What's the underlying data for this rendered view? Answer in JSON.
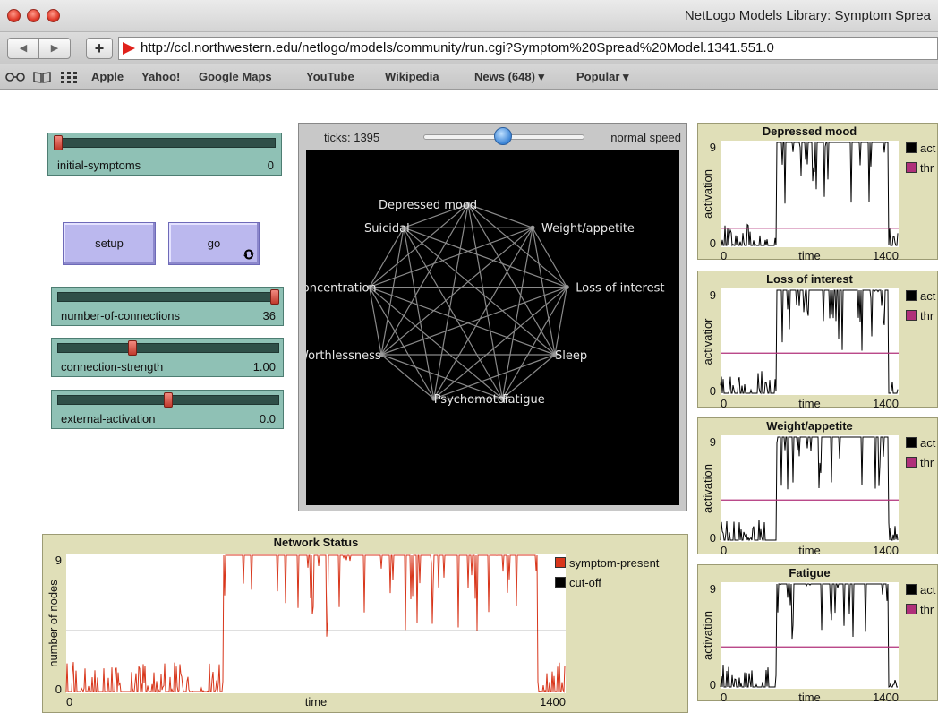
{
  "browser": {
    "window_title": "NetLogo Models Library: Symptom Sprea",
    "url": "http://ccl.northwestern.edu/netlogo/models/community/run.cgi?Symptom%20Spread%20Model.1341.551.0",
    "add_label": "+",
    "back_label": "◀",
    "forward_label": "▶",
    "bookmarks": [
      "Apple",
      "Yahoo!",
      "Google Maps",
      "YouTube",
      "Wikipedia",
      "News (648) ▾",
      "Popular ▾"
    ],
    "reader_icon": "glasses-icon",
    "book_icon": "book-icon",
    "grid_icon": "top-sites-icon"
  },
  "controls": {
    "sliders": [
      {
        "label": "initial-symptoms",
        "value": "0",
        "level": 0.0
      },
      {
        "label": "number-of-connections",
        "value": "36",
        "level": 1.0
      },
      {
        "label": "connection-strength",
        "value": "1.00",
        "level": 0.33
      },
      {
        "label": "external-activation",
        "value": "0.0",
        "level": 0.5
      }
    ],
    "setup_label": "setup",
    "go_label": "go",
    "forever_icon": "forever-icon"
  },
  "view": {
    "ticks": "ticks: 1395",
    "speed_label": "normal speed",
    "speed_level": 0.5,
    "nodes": [
      "Depressed mood",
      "Weight/appetite",
      "Loss of interest",
      "Sleep",
      "Fatigue",
      "Psychomotor",
      "Worthlessness",
      "Concentration",
      "Suicidal"
    ]
  },
  "colors": {
    "slider": "#8fc1b5",
    "button": "#bbb8ee",
    "plot_bg": "#e0dfb8",
    "symptom": "#d8361b",
    "threshold": "#b0307a"
  },
  "small_plots": [
    {
      "title": "Depressed mood",
      "ylabel": "activation",
      "xlabel": "time",
      "ymax": "9",
      "ymin": "0",
      "xmin": "0",
      "xmax": "1400",
      "legend": [
        "act",
        "thr"
      ]
    },
    {
      "title": "Loss of interest",
      "ylabel": "activatior",
      "xlabel": "time",
      "ymax": "9",
      "ymin": "0",
      "xmin": "0",
      "xmax": "1400",
      "legend": [
        "act",
        "thr"
      ]
    },
    {
      "title": "Weight/appetite",
      "ylabel": "activation",
      "xlabel": "time",
      "ymax": "9",
      "ymin": "0",
      "xmin": "0",
      "xmax": "1400",
      "legend": [
        "act",
        "thr"
      ]
    },
    {
      "title": "Fatigue",
      "ylabel": "activation",
      "xlabel": "time",
      "ymax": "9",
      "ymin": "0",
      "xmin": "0",
      "xmax": "1400",
      "legend": [
        "act",
        "thr"
      ]
    }
  ],
  "network_plot": {
    "title": "Network Status",
    "ylabel": "number of nodes",
    "xlabel": "time",
    "ymax": "9",
    "ymin": "0",
    "xmin": "0",
    "xmax": "1400",
    "legend": [
      "symptom-present",
      "cut-off"
    ]
  },
  "chart_data": [
    {
      "type": "line",
      "title": "Network Status",
      "xlabel": "time",
      "ylabel": "number of nodes",
      "xlim": [
        0,
        1400
      ],
      "ylim": [
        0,
        9
      ],
      "series": [
        {
          "name": "symptom-present",
          "segments": [
            {
              "x": [
                0,
                440
              ],
              "level": 0
            },
            {
              "x": [
                440,
                1320
              ],
              "level": 9
            },
            {
              "x": [
                1320,
                1400
              ],
              "level": 0
            }
          ]
        },
        {
          "name": "cut-off",
          "constant": 4
        }
      ]
    },
    {
      "type": "line",
      "title": "Depressed mood",
      "xlabel": "time",
      "ylabel": "activation",
      "xlim": [
        0,
        1400
      ],
      "ylim": [
        0,
        9
      ],
      "series": [
        {
          "name": "act",
          "high_interval": [
            440,
            1320
          ]
        },
        {
          "name": "thr",
          "constant": 1.5
        }
      ]
    },
    {
      "type": "line",
      "title": "Loss of interest",
      "xlabel": "time",
      "ylabel": "activatior",
      "xlim": [
        0,
        1400
      ],
      "ylim": [
        0,
        9
      ],
      "series": [
        {
          "name": "act",
          "high_interval": [
            440,
            1320
          ]
        },
        {
          "name": "thr",
          "constant": 3.5
        }
      ]
    },
    {
      "type": "line",
      "title": "Weight/appetite",
      "xlabel": "time",
      "ylabel": "activation",
      "xlim": [
        0,
        1400
      ],
      "ylim": [
        0,
        9
      ],
      "series": [
        {
          "name": "act",
          "high_interval": [
            440,
            1320
          ]
        },
        {
          "name": "thr",
          "constant": 3.5
        }
      ]
    },
    {
      "type": "line",
      "title": "Fatigue",
      "xlabel": "time",
      "ylabel": "activation",
      "xlim": [
        0,
        1400
      ],
      "ylim": [
        0,
        9
      ],
      "series": [
        {
          "name": "act",
          "high_interval": [
            440,
            1320
          ]
        },
        {
          "name": "thr",
          "constant": 3.5
        }
      ]
    }
  ]
}
